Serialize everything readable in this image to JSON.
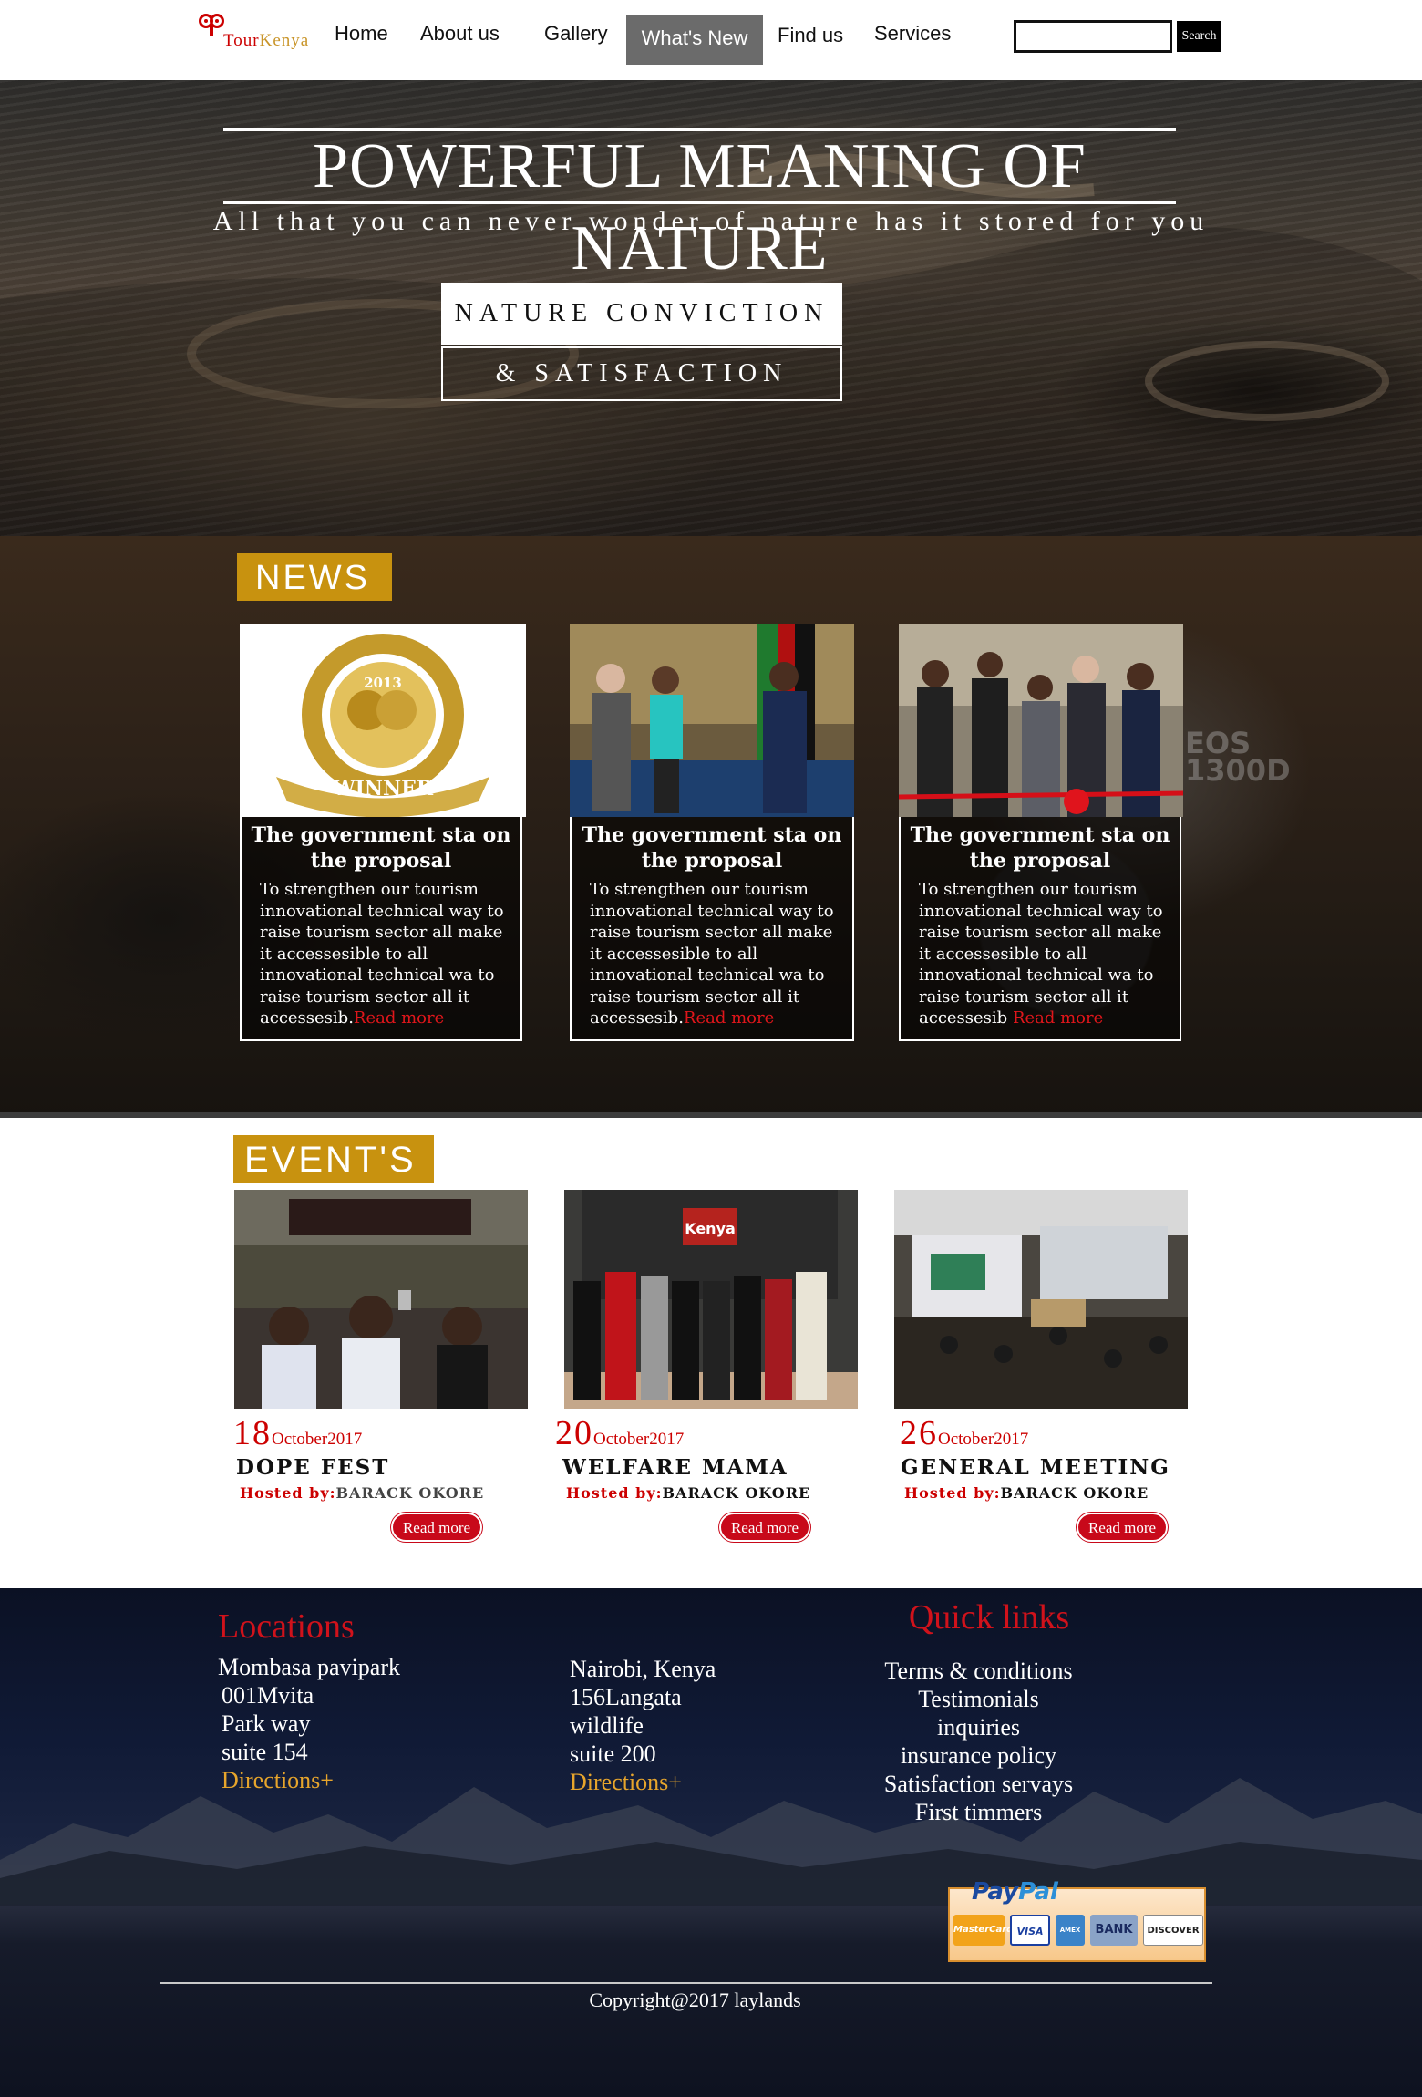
{
  "header": {
    "logo": {
      "brand_t": "T",
      "brand_our": "our",
      "brand_kenya": "Kenya"
    },
    "nav": [
      "Home",
      "About us",
      "Gallery",
      "What's New",
      "Find us",
      "Services"
    ],
    "active_nav": "What's New",
    "search": {
      "placeholder": "",
      "button": "Search"
    }
  },
  "hero": {
    "title": "POWERFUL MEANING OF NATURE",
    "subtitle": "All that you can never wonder of nature has it stored for you",
    "box1": "NATURE CONVICTION",
    "box2": "& SATISFACTION"
  },
  "news": {
    "label": "NEWS",
    "cards": [
      {
        "image": "world-travel-awards-winner-2013",
        "title": "The government sta on the proposal",
        "text": "To strengthen our tourism innovational technical way to raise tourism sector all make it accessesible to all innovational technical wa to raise tourism sector all it accessesib.",
        "more": "Read more"
      },
      {
        "image": "handshake-officials",
        "title": "The government sta on the proposal",
        "text": "To strengthen our tourism innovational technical way to raise tourism sector all make it accessesible to all innovational technical wa to raise tourism sector all it accessesib.",
        "more": "Read more"
      },
      {
        "image": "ribbon-cutting",
        "title": "The government sta on the proposal",
        "text": "To strengthen our tourism innovational technical way to raise tourism sector all make it accessesible to all innovational technical wa to raise tourism sector all it accessesib",
        "more": "Read more"
      }
    ]
  },
  "events": {
    "label": "EVENT'S",
    "items": [
      {
        "image": "crowd-concert",
        "day": "18",
        "month": "October2017",
        "title": "DOPE FEST",
        "host_label": "Hosted by:",
        "host": "BARACK OKORE",
        "button": "Read more"
      },
      {
        "image": "magical-kenya-group",
        "day": "20",
        "month": "October2017",
        "title": "WELFARE MAMA",
        "host_label": "Hosted by:",
        "host": "BARACK OKORE",
        "button": "Read more"
      },
      {
        "image": "expo-booth-crowd",
        "day": "26",
        "month": "October2017",
        "title": "GENERAL MEETING",
        "host_label": "Hosted by:",
        "host": "BARACK OKORE",
        "button": "Read more"
      }
    ]
  },
  "footer": {
    "locations_heading": "Locations",
    "location1": [
      "Mombasa pavipark",
      "001Mvita",
      "Park way",
      "suite 154"
    ],
    "location2": [
      "Nairobi, Kenya",
      "156Langata",
      "wildlife",
      "suite 200"
    ],
    "directions": "Directions+",
    "quick_links_heading": "Quick links",
    "quick_links": [
      "Terms & conditions",
      "Testimonials",
      "inquiries",
      "insurance policy",
      "Satisfaction servays",
      "First timmers"
    ],
    "payment": {
      "brand_pay": "Pay",
      "brand_pal": "Pal",
      "cards": [
        "MasterCard",
        "VISA",
        "AMEX",
        "BANK",
        "DISCOVER"
      ]
    },
    "copyright": "Copyright@2017 laylands"
  },
  "colors": {
    "accent_gold": "#c8920f",
    "accent_red": "#c8091a",
    "nav_active": "#6b6b6b"
  }
}
